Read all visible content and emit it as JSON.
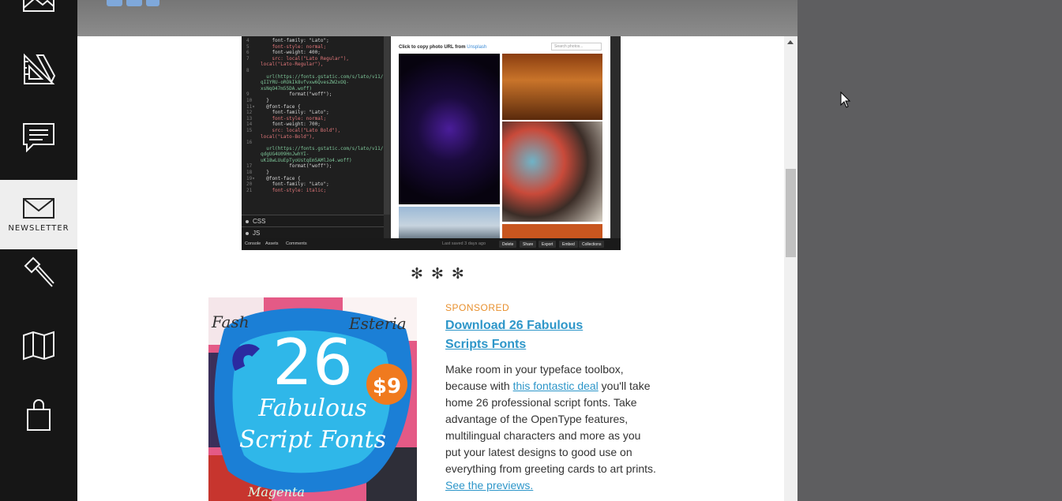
{
  "nav": {
    "newsletter_label": "NEWSLETTER"
  },
  "code_screenshot": {
    "lines": [
      {
        "n": "4",
        "t": "    font-family: \"Lato\";"
      },
      {
        "n": "5",
        "t": "    font-style: normal;"
      },
      {
        "n": "6",
        "t": "    font-weight: 400;"
      },
      {
        "n": "7",
        "t": "    src: local(\"Lato Regular\"),"
      },
      {
        "n": "",
        "t": "local(\"Lato-Regular\"),"
      },
      {
        "n": "8",
        "t": ""
      },
      {
        "n": "",
        "t": "  url(https://fonts.gstatic.com/s/lato/v11/"
      },
      {
        "n": "",
        "t": "qIIYRU-oROkIk8vfvxw6QvesZW2xOQ-"
      },
      {
        "n": "",
        "t": "xsNqO47m55DA.woff)"
      },
      {
        "n": "9",
        "t": "          format(\"woff\");"
      },
      {
        "n": "10",
        "t": "  }"
      },
      {
        "n": "11▾",
        "t": "  @font-face {"
      },
      {
        "n": "12",
        "t": "    font-family: \"Lato\";"
      },
      {
        "n": "13",
        "t": "    font-style: normal;"
      },
      {
        "n": "14",
        "t": "    font-weight: 700;"
      },
      {
        "n": "15",
        "t": "    src: local(\"Lato Bold\"),"
      },
      {
        "n": "",
        "t": "local(\"Lato-Bold\"),"
      },
      {
        "n": "16",
        "t": ""
      },
      {
        "n": "",
        "t": "  url(https://fonts.gstatic.com/s/lato/v11/"
      },
      {
        "n": "",
        "t": "qdgUG4U09HnJwhYI-"
      },
      {
        "n": "",
        "t": "uK18wLUuEpTyoUstqEm5AMlJo4.woff)"
      },
      {
        "n": "17",
        "t": "          format(\"woff\");"
      },
      {
        "n": "18",
        "t": "  }"
      },
      {
        "n": "19▾",
        "t": "  @font-face {"
      },
      {
        "n": "20",
        "t": "    font-family: \"Lato\";"
      },
      {
        "n": "21",
        "t": "    font-style: italic;"
      }
    ],
    "css_panel": "CSS",
    "js_panel": "JS",
    "preview_caption_prefix": "Click to copy photo URL from ",
    "preview_caption_link": "Unsplash",
    "search_placeholder": "Search photos...",
    "saved_text": "Last saved 3 days ago",
    "buttons": [
      "Delete",
      "Share",
      "Export",
      "Embed",
      "Collections"
    ],
    "left_tabs": [
      "Console",
      "Assets",
      "Comments"
    ]
  },
  "separator": "✻ ✻ ✻",
  "promo": {
    "sponsored": "SPONSORED",
    "title": "Download 26 Fabulous Scripts Fonts",
    "body_before_link": "Make room in your typeface toolbox, because with ",
    "link_text": "this fontastic deal",
    "body_after_link": " you'll take home 26 professional script fonts. Take advantage of the OpenType features, multilingual characters and more as you put your latest designs to good use on everything from greeting cards to art prints. ",
    "previews_link": "See the previews.",
    "image_big_number": "26",
    "image_line1": "Fabulous",
    "image_line2": "Script Fonts",
    "image_price": "$9",
    "image_corner_word": "Fash",
    "image_corner_word2": "Esteria",
    "image_bottom_word": "Magenta"
  },
  "colors": {
    "accent_link": "#2d96c9",
    "sponsored": "#e8902e",
    "sidebar": "#161616",
    "backdrop": "#5e5e60"
  }
}
